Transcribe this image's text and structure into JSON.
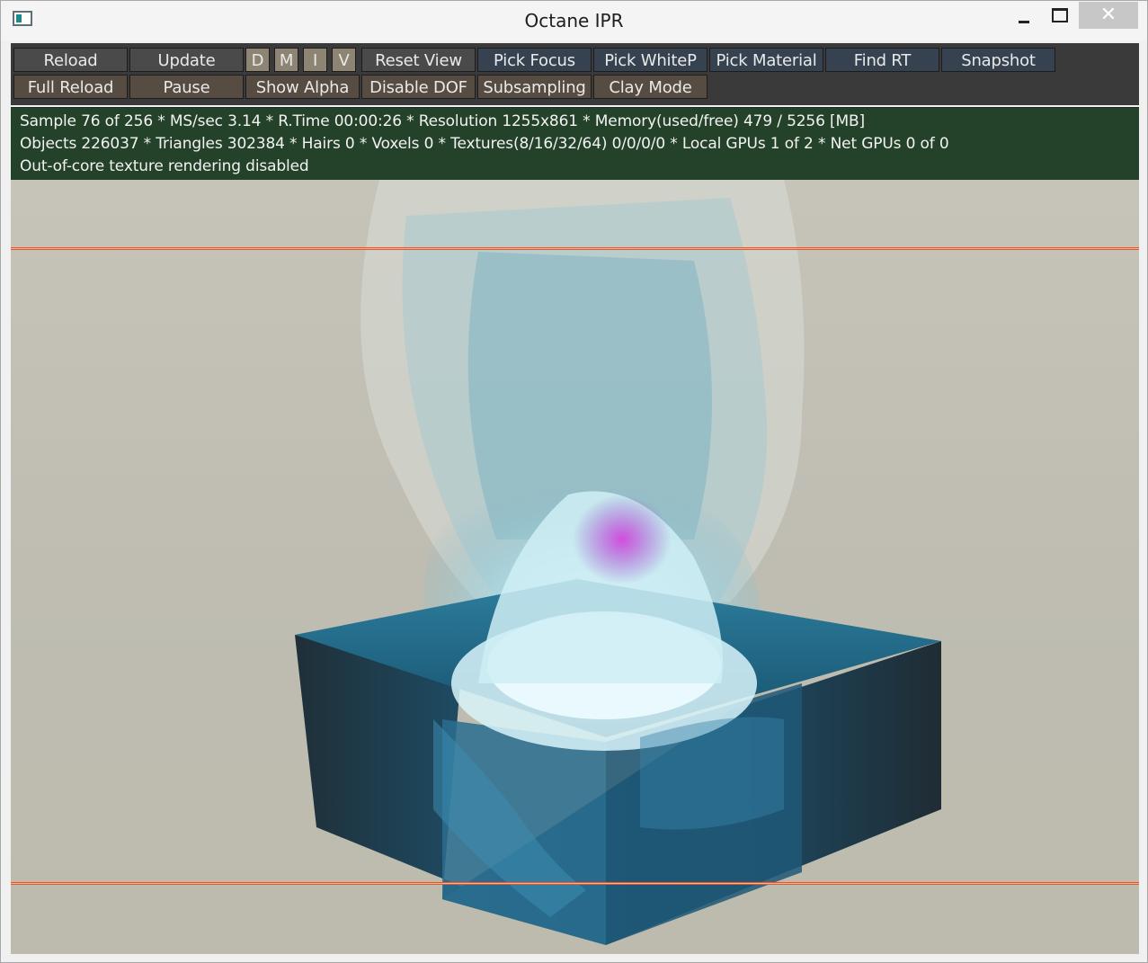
{
  "window": {
    "title": "Octane IPR",
    "close_glyph": "✕"
  },
  "toolbar": {
    "row1": [
      {
        "label": "Reload",
        "icon": ""
      },
      {
        "label": "Update"
      },
      {
        "label": "D"
      },
      {
        "label": "M"
      },
      {
        "label": "I"
      },
      {
        "label": "V"
      },
      {
        "label": "Reset View"
      },
      {
        "label": "Pick Focus"
      },
      {
        "label": "Pick WhiteP"
      },
      {
        "label": "Pick Material"
      },
      {
        "label": "Find RT"
      },
      {
        "label": "Snapshot"
      }
    ],
    "row2": [
      {
        "label": "Full Reload"
      },
      {
        "label": "Pause"
      },
      {
        "label": "Show Alpha"
      },
      {
        "label": "Disable DOF"
      },
      {
        "label": "Subsampling"
      },
      {
        "label": "Clay Mode"
      }
    ]
  },
  "status": {
    "line1": "Sample 76 of 256 * MS/sec 3.14 * R.Time 00:00:26 * Resolution 1255x861 * Memory(used/free) 479 / 5256 [MB]",
    "line2": "Objects 226037 * Triangles 302384 * Hairs 0 * Voxels 0 * Textures(8/16/32/64) 0/0/0/0 * Local GPUs 1 of 2 * Net GPUs 0 of 0",
    "line3": "Out-of-core texture rendering disabled"
  },
  "colors": {
    "toolbar_bg": "#3a3a3a",
    "status_bg": "#24422a",
    "guide_line": "#e8562b",
    "water": "#1f6d8c",
    "splash": "#bfe9ef",
    "magenta_particles": "#c63ad1"
  },
  "icons": {
    "app": "octane-window-icon",
    "minimize": "minimize-icon",
    "maximize": "maximize-icon",
    "close": "close-icon"
  }
}
